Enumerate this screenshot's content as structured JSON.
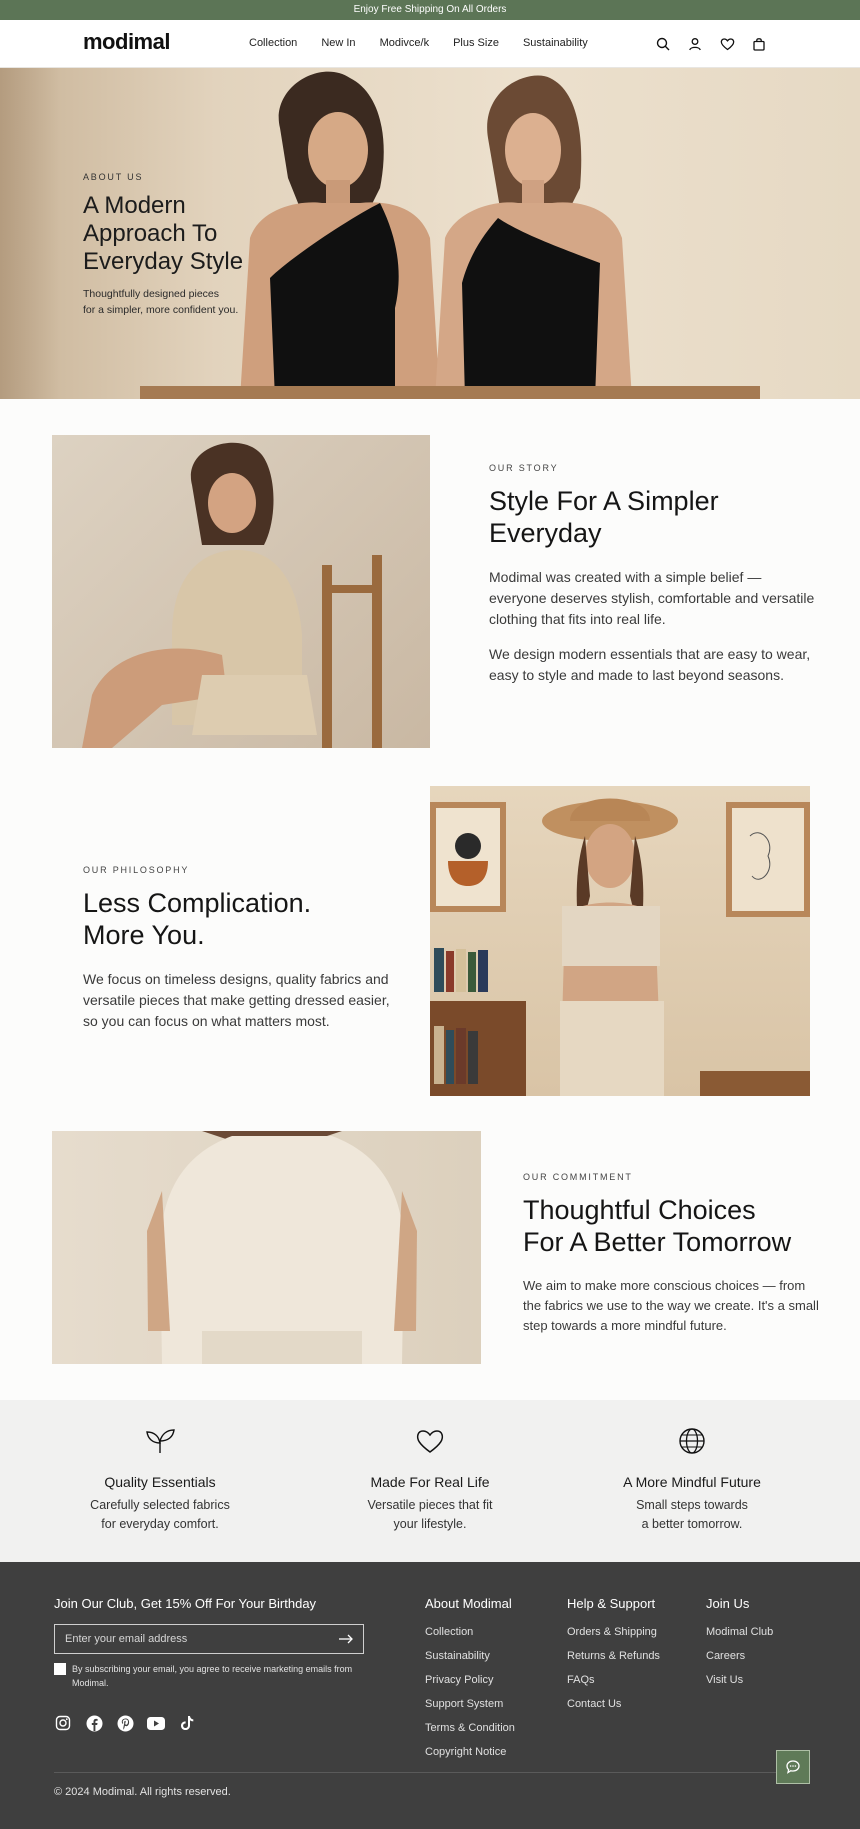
{
  "announcement": "Enjoy Free Shipping On All Orders",
  "header": {
    "logo": "modimal",
    "nav": [
      "Collection",
      "New In",
      "Modivce/k",
      "Plus Size",
      "Sustainability"
    ],
    "icons": [
      "search-icon",
      "user-icon",
      "heart-icon",
      "bag-icon"
    ]
  },
  "hero": {
    "eyebrow": "ABOUT US",
    "title_lines": [
      "A Modern",
      "Approach To",
      "Everyday Style"
    ],
    "subtitle_lines": [
      "Thoughtfully designed pieces",
      "for a simpler, more confident you."
    ]
  },
  "story": {
    "eyebrow": "OUR STORY",
    "title_lines": [
      "Style For A Simpler",
      "Everyday"
    ],
    "paragraphs": [
      "Modimal was created with a simple belief — everyone deserves stylish, comfortable and versatile clothing that fits into real life.",
      "We design modern essentials that are easy to wear, easy to style and made to last beyond seasons."
    ]
  },
  "philosophy": {
    "eyebrow": "OUR PHILOSOPHY",
    "title_lines": [
      "Less Complication.",
      "More You."
    ],
    "paragraphs": [
      "We focus on timeless designs, quality fabrics and versatile pieces that make getting dressed easier, so you can focus on what matters most."
    ]
  },
  "commitment": {
    "eyebrow": "OUR COMMITMENT",
    "title_lines": [
      "Thoughtful Choices",
      "For A Better Tomorrow"
    ],
    "paragraphs": [
      "We aim to make more conscious choices — from the fabrics we use to the way we create. It's a small step towards a more mindful future."
    ]
  },
  "features": [
    {
      "icon": "leaf-icon",
      "title": "Quality Essentials",
      "desc_lines": [
        "Carefully selected fabrics",
        "for everyday comfort."
      ]
    },
    {
      "icon": "heart-icon",
      "title": "Made For Real Life",
      "desc_lines": [
        "Versatile pieces that fit",
        "your lifestyle."
      ]
    },
    {
      "icon": "globe-icon",
      "title": "A More Mindful Future",
      "desc_lines": [
        "Small steps towards",
        "a better tomorrow."
      ]
    }
  ],
  "footer": {
    "club_title": "Join Our Club, Get 15% Off For Your Birthday",
    "email_placeholder": "Enter your email address",
    "consent": "By subscribing your email, you agree to receive marketing emails from Modimal.",
    "social": [
      "instagram-icon",
      "facebook-icon",
      "pinterest-icon",
      "youtube-icon",
      "tiktok-icon"
    ],
    "columns": [
      {
        "heading": "About Modimal",
        "links": [
          "Collection",
          "Sustainability",
          "Privacy Policy",
          "Support System",
          "Terms & Condition",
          "Copyright Notice"
        ]
      },
      {
        "heading": "Help & Support",
        "links": [
          "Orders & Shipping",
          "Returns & Refunds",
          "FAQs",
          "Contact Us"
        ]
      },
      {
        "heading": "Join Us",
        "links": [
          "Modimal Club",
          "Careers",
          "Visit Us"
        ]
      }
    ],
    "copyright": "© 2024 Modimal. All rights reserved."
  },
  "colors": {
    "accent_green": "#5c7556",
    "footer_bg": "#3f3f3f",
    "features_bg": "#f1f1f0"
  }
}
